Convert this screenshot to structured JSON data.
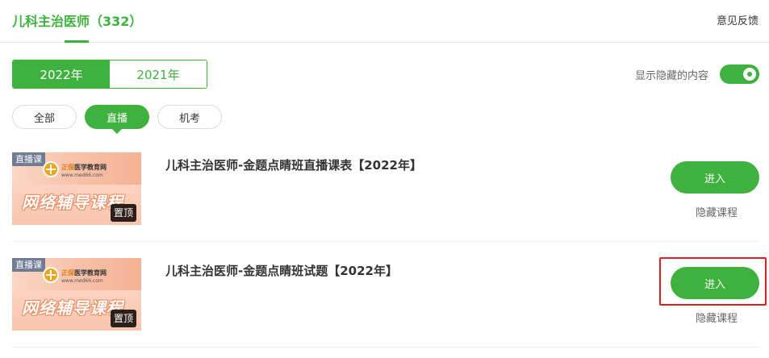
{
  "header": {
    "title": "儿科主治医师（332）",
    "feedback": "意见反馈"
  },
  "year_tabs": [
    {
      "label": "2022年",
      "active": true
    },
    {
      "label": "2021年",
      "active": false
    }
  ],
  "show_hidden": {
    "label": "显示隐藏的内容",
    "on": true
  },
  "filters": [
    {
      "label": "全部",
      "active": false
    },
    {
      "label": "直播",
      "active": true
    },
    {
      "label": "机考",
      "active": false
    }
  ],
  "courses": [
    {
      "tag": "直播课",
      "thumb_brand_a": "正保",
      "thumb_brand_b": "医学教育网",
      "thumb_url": "www.med66.com",
      "thumb_banner": "网络辅导课程",
      "pin": "置顶",
      "title": "儿科主治医师-金题点睛班直播课表【2022年】",
      "enter": "进入",
      "hide": "隐藏课程"
    },
    {
      "tag": "直播课",
      "thumb_brand_a": "正保",
      "thumb_brand_b": "医学教育网",
      "thumb_url": "www.med66.com",
      "thumb_banner": "网络辅导课程",
      "pin": "置顶",
      "title": "儿科主治医师-金题点睛班试题【2022年】",
      "enter": "进入",
      "hide": "隐藏课程"
    }
  ],
  "colors": {
    "accent": "#3fb13f",
    "highlight": "#e02020"
  }
}
